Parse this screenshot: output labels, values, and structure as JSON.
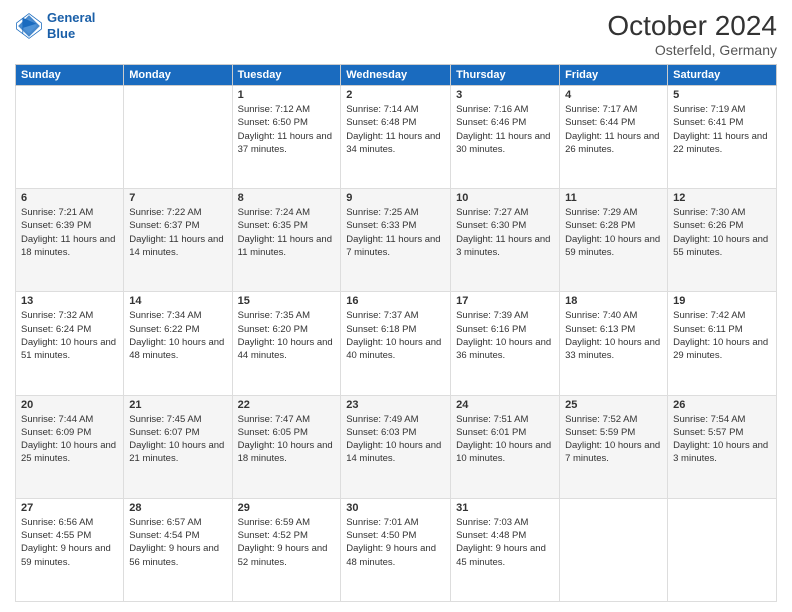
{
  "logo": {
    "line1": "General",
    "line2": "Blue"
  },
  "title": "October 2024",
  "location": "Osterfeld, Germany",
  "days_header": [
    "Sunday",
    "Monday",
    "Tuesday",
    "Wednesday",
    "Thursday",
    "Friday",
    "Saturday"
  ],
  "weeks": [
    [
      {
        "day": "",
        "sunrise": "",
        "sunset": "",
        "daylight": ""
      },
      {
        "day": "",
        "sunrise": "",
        "sunset": "",
        "daylight": ""
      },
      {
        "day": "1",
        "sunrise": "Sunrise: 7:12 AM",
        "sunset": "Sunset: 6:50 PM",
        "daylight": "Daylight: 11 hours and 37 minutes."
      },
      {
        "day": "2",
        "sunrise": "Sunrise: 7:14 AM",
        "sunset": "Sunset: 6:48 PM",
        "daylight": "Daylight: 11 hours and 34 minutes."
      },
      {
        "day": "3",
        "sunrise": "Sunrise: 7:16 AM",
        "sunset": "Sunset: 6:46 PM",
        "daylight": "Daylight: 11 hours and 30 minutes."
      },
      {
        "day": "4",
        "sunrise": "Sunrise: 7:17 AM",
        "sunset": "Sunset: 6:44 PM",
        "daylight": "Daylight: 11 hours and 26 minutes."
      },
      {
        "day": "5",
        "sunrise": "Sunrise: 7:19 AM",
        "sunset": "Sunset: 6:41 PM",
        "daylight": "Daylight: 11 hours and 22 minutes."
      }
    ],
    [
      {
        "day": "6",
        "sunrise": "Sunrise: 7:21 AM",
        "sunset": "Sunset: 6:39 PM",
        "daylight": "Daylight: 11 hours and 18 minutes."
      },
      {
        "day": "7",
        "sunrise": "Sunrise: 7:22 AM",
        "sunset": "Sunset: 6:37 PM",
        "daylight": "Daylight: 11 hours and 14 minutes."
      },
      {
        "day": "8",
        "sunrise": "Sunrise: 7:24 AM",
        "sunset": "Sunset: 6:35 PM",
        "daylight": "Daylight: 11 hours and 11 minutes."
      },
      {
        "day": "9",
        "sunrise": "Sunrise: 7:25 AM",
        "sunset": "Sunset: 6:33 PM",
        "daylight": "Daylight: 11 hours and 7 minutes."
      },
      {
        "day": "10",
        "sunrise": "Sunrise: 7:27 AM",
        "sunset": "Sunset: 6:30 PM",
        "daylight": "Daylight: 11 hours and 3 minutes."
      },
      {
        "day": "11",
        "sunrise": "Sunrise: 7:29 AM",
        "sunset": "Sunset: 6:28 PM",
        "daylight": "Daylight: 10 hours and 59 minutes."
      },
      {
        "day": "12",
        "sunrise": "Sunrise: 7:30 AM",
        "sunset": "Sunset: 6:26 PM",
        "daylight": "Daylight: 10 hours and 55 minutes."
      }
    ],
    [
      {
        "day": "13",
        "sunrise": "Sunrise: 7:32 AM",
        "sunset": "Sunset: 6:24 PM",
        "daylight": "Daylight: 10 hours and 51 minutes."
      },
      {
        "day": "14",
        "sunrise": "Sunrise: 7:34 AM",
        "sunset": "Sunset: 6:22 PM",
        "daylight": "Daylight: 10 hours and 48 minutes."
      },
      {
        "day": "15",
        "sunrise": "Sunrise: 7:35 AM",
        "sunset": "Sunset: 6:20 PM",
        "daylight": "Daylight: 10 hours and 44 minutes."
      },
      {
        "day": "16",
        "sunrise": "Sunrise: 7:37 AM",
        "sunset": "Sunset: 6:18 PM",
        "daylight": "Daylight: 10 hours and 40 minutes."
      },
      {
        "day": "17",
        "sunrise": "Sunrise: 7:39 AM",
        "sunset": "Sunset: 6:16 PM",
        "daylight": "Daylight: 10 hours and 36 minutes."
      },
      {
        "day": "18",
        "sunrise": "Sunrise: 7:40 AM",
        "sunset": "Sunset: 6:13 PM",
        "daylight": "Daylight: 10 hours and 33 minutes."
      },
      {
        "day": "19",
        "sunrise": "Sunrise: 7:42 AM",
        "sunset": "Sunset: 6:11 PM",
        "daylight": "Daylight: 10 hours and 29 minutes."
      }
    ],
    [
      {
        "day": "20",
        "sunrise": "Sunrise: 7:44 AM",
        "sunset": "Sunset: 6:09 PM",
        "daylight": "Daylight: 10 hours and 25 minutes."
      },
      {
        "day": "21",
        "sunrise": "Sunrise: 7:45 AM",
        "sunset": "Sunset: 6:07 PM",
        "daylight": "Daylight: 10 hours and 21 minutes."
      },
      {
        "day": "22",
        "sunrise": "Sunrise: 7:47 AM",
        "sunset": "Sunset: 6:05 PM",
        "daylight": "Daylight: 10 hours and 18 minutes."
      },
      {
        "day": "23",
        "sunrise": "Sunrise: 7:49 AM",
        "sunset": "Sunset: 6:03 PM",
        "daylight": "Daylight: 10 hours and 14 minutes."
      },
      {
        "day": "24",
        "sunrise": "Sunrise: 7:51 AM",
        "sunset": "Sunset: 6:01 PM",
        "daylight": "Daylight: 10 hours and 10 minutes."
      },
      {
        "day": "25",
        "sunrise": "Sunrise: 7:52 AM",
        "sunset": "Sunset: 5:59 PM",
        "daylight": "Daylight: 10 hours and 7 minutes."
      },
      {
        "day": "26",
        "sunrise": "Sunrise: 7:54 AM",
        "sunset": "Sunset: 5:57 PM",
        "daylight": "Daylight: 10 hours and 3 minutes."
      }
    ],
    [
      {
        "day": "27",
        "sunrise": "Sunrise: 6:56 AM",
        "sunset": "Sunset: 4:55 PM",
        "daylight": "Daylight: 9 hours and 59 minutes."
      },
      {
        "day": "28",
        "sunrise": "Sunrise: 6:57 AM",
        "sunset": "Sunset: 4:54 PM",
        "daylight": "Daylight: 9 hours and 56 minutes."
      },
      {
        "day": "29",
        "sunrise": "Sunrise: 6:59 AM",
        "sunset": "Sunset: 4:52 PM",
        "daylight": "Daylight: 9 hours and 52 minutes."
      },
      {
        "day": "30",
        "sunrise": "Sunrise: 7:01 AM",
        "sunset": "Sunset: 4:50 PM",
        "daylight": "Daylight: 9 hours and 48 minutes."
      },
      {
        "day": "31",
        "sunrise": "Sunrise: 7:03 AM",
        "sunset": "Sunset: 4:48 PM",
        "daylight": "Daylight: 9 hours and 45 minutes."
      },
      {
        "day": "",
        "sunrise": "",
        "sunset": "",
        "daylight": ""
      },
      {
        "day": "",
        "sunrise": "",
        "sunset": "",
        "daylight": ""
      }
    ]
  ]
}
